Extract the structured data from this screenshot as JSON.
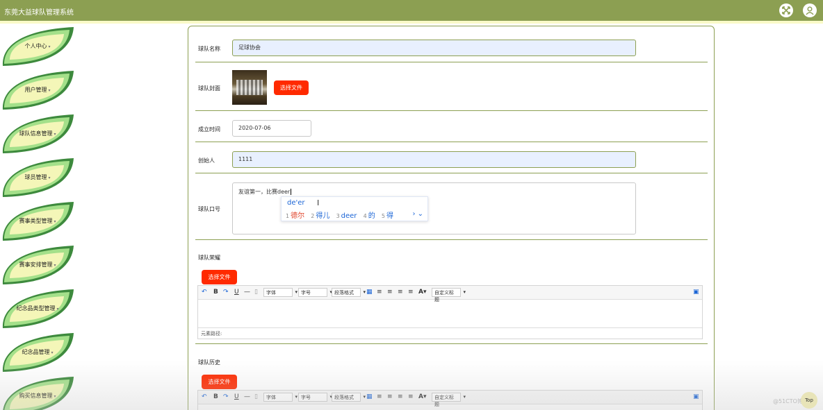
{
  "app": {
    "title": "东莞大益球队管理系统"
  },
  "header": {
    "icons": [
      "fullscreen-icon",
      "user-icon"
    ]
  },
  "sidebar": {
    "items": [
      {
        "label": "个人中心"
      },
      {
        "label": "用户管理"
      },
      {
        "label": "球队信息管理"
      },
      {
        "label": "球员管理"
      },
      {
        "label": "赛事类型管理"
      },
      {
        "label": "赛事安排管理"
      },
      {
        "label": "纪念品类型管理"
      },
      {
        "label": "纪念品管理"
      },
      {
        "label": "购买信息管理"
      }
    ]
  },
  "form": {
    "team_name": {
      "label": "球队名称",
      "value": "足球协会"
    },
    "cover": {
      "label": "球队封面",
      "button": "选择文件"
    },
    "founded": {
      "label": "成立时间",
      "value": "2020-07-06"
    },
    "founder": {
      "label": "创始人",
      "value": "1111"
    },
    "slogan": {
      "label": "球队口号",
      "value": "友谊第一，比赛deer"
    },
    "honors": {
      "label": "球队荣耀",
      "button": "选择文件"
    },
    "history": {
      "label": "球队历史",
      "button": "选择文件"
    }
  },
  "ime": {
    "pinyin": "de'er",
    "candidates": [
      {
        "num": "1",
        "text": "德尔"
      },
      {
        "num": "2",
        "text": "得儿"
      },
      {
        "num": "3",
        "text": "deer"
      },
      {
        "num": "4",
        "text": "的"
      },
      {
        "num": "5",
        "text": "得"
      }
    ]
  },
  "editor": {
    "font_select": "字体",
    "size_select": "字号",
    "para_select": "段落格式",
    "custom_select": "自定义标题",
    "status": "元素路径:"
  },
  "footer": {
    "top_button": "Top",
    "watermark": "@51CTO博客"
  },
  "colors": {
    "header": "#8c9f52",
    "accent_red": "#ff2a00",
    "leaf_dark": "#3d8a3d",
    "leaf_light": "#a4e08a",
    "leaf_fill": "#f4f6b8"
  }
}
